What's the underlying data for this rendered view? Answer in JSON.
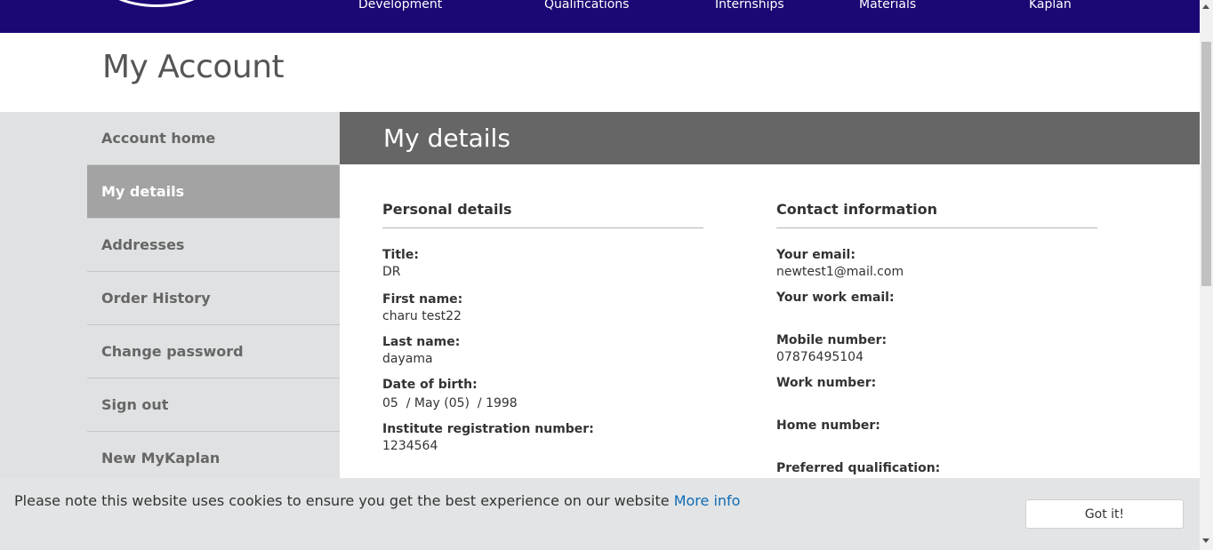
{
  "nav": {
    "items": [
      "Development",
      "Qualifications",
      "Internships",
      "Materials",
      "Kaplan"
    ]
  },
  "page_title": "My Account",
  "sidebar": {
    "items": [
      {
        "label": "Account home"
      },
      {
        "label": "My details"
      },
      {
        "label": "Addresses"
      },
      {
        "label": "Order History"
      },
      {
        "label": "Change password"
      },
      {
        "label": "Sign out"
      },
      {
        "label": "New MyKaplan"
      }
    ]
  },
  "content": {
    "heading": "My details",
    "personal": {
      "heading": "Personal details",
      "fields": [
        {
          "label": "Title:",
          "value": "DR"
        },
        {
          "label": "First name:",
          "value": "charu test22"
        },
        {
          "label": "Last name:",
          "value": "dayama"
        },
        {
          "label": "Date of birth:",
          "value": "05  / May (05)  / 1998"
        },
        {
          "label": "Institute registration number:",
          "value": "1234564"
        }
      ]
    },
    "contact": {
      "heading": "Contact information",
      "fields": [
        {
          "label": "Your email:",
          "value": "newtest1@mail.com"
        },
        {
          "label": "Your work email:",
          "value": ""
        },
        {
          "label": "Mobile number:",
          "value": "07876495104"
        },
        {
          "label": "Work number:",
          "value": ""
        },
        {
          "label": "Home number:",
          "value": ""
        },
        {
          "label": "Preferred qualification:",
          "value": ""
        }
      ]
    }
  },
  "cookie": {
    "text": "Please note this website uses cookies to ensure you get the best experience on our website ",
    "link": "More info",
    "button": "Got it!"
  },
  "colors": {
    "nav_bg": "#1c0774",
    "header_bar": "#666666",
    "active_item": "#a3a3a3",
    "link": "#0f6cb6"
  }
}
